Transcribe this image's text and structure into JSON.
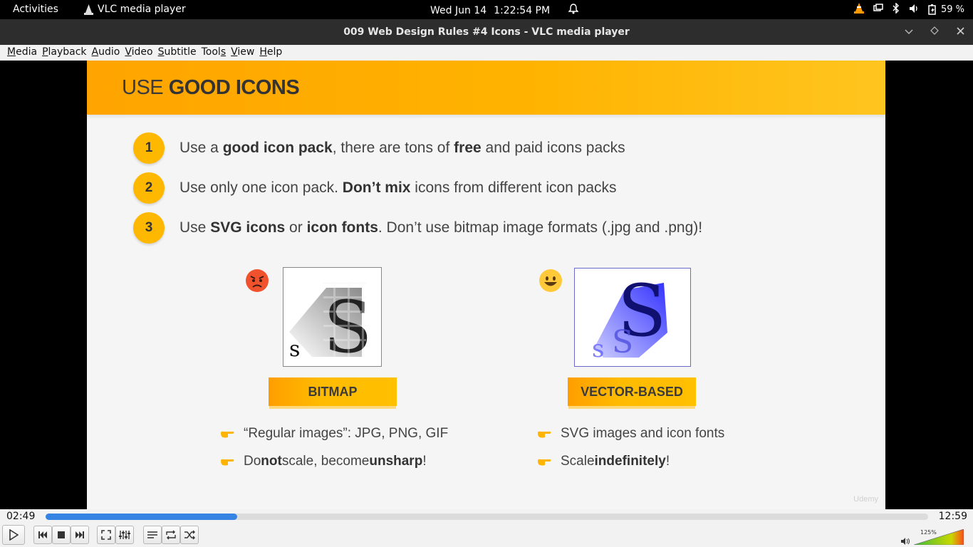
{
  "topbar": {
    "activities": "Activities",
    "app_name": "VLC media player",
    "date": "Wed Jun 14",
    "time": "1:22:54 PM",
    "battery": "59 %"
  },
  "window": {
    "title": "009 Web Design Rules #4 Icons - VLC media player"
  },
  "menu": {
    "items": [
      {
        "first": "M",
        "rest": "edia"
      },
      {
        "first": "P",
        "rest": "layback"
      },
      {
        "first": "A",
        "rest": "udio"
      },
      {
        "first": "V",
        "rest": "ideo"
      },
      {
        "first": "S",
        "rest": "ubtitle"
      },
      {
        "first": "Tool",
        "rest": "s",
        "underline_last": true
      },
      {
        "first": "V",
        "rest": "iew"
      },
      {
        "first": "H",
        "rest": "elp"
      }
    ]
  },
  "slide": {
    "title_light": "USE ",
    "title_bold": "GOOD ICONS",
    "rules": [
      {
        "num": "1",
        "parts": [
          "Use a ",
          "good icon pack",
          ", there are tons of ",
          "free",
          " and paid icons packs"
        ]
      },
      {
        "num": "2",
        "parts": [
          "Use only one icon pack. ",
          "Don’t mix",
          " icons from different icon packs",
          "",
          ""
        ]
      },
      {
        "num": "3",
        "parts": [
          "Use ",
          "SVG icons",
          " or ",
          "icon fonts",
          ". Don’t use bitmap image formats (.jpg and .png)!"
        ]
      }
    ],
    "left": {
      "tag": "BITMAP",
      "bullets": [
        {
          "a": "“Regular images”: JPG, PNG, GIF",
          "b": "",
          "c": "",
          "d": "",
          "e": ""
        },
        {
          "a": "Do ",
          "b": "not",
          "c": " scale, become ",
          "d": "unsharp",
          "e": "!"
        }
      ]
    },
    "right": {
      "tag": "VECTOR-BASED",
      "bullets": [
        {
          "a": "SVG images and icon fonts",
          "b": "",
          "c": ""
        },
        {
          "a": "Scale ",
          "b": "indefinitely",
          "c": "!"
        }
      ]
    },
    "watermark": "Udemy"
  },
  "player": {
    "current_time": "02:49",
    "total_time": "12:59",
    "progress": 0.217,
    "volume": "125%"
  },
  "colors": {
    "accent": "#ffb800",
    "progress": "#3584e4"
  }
}
